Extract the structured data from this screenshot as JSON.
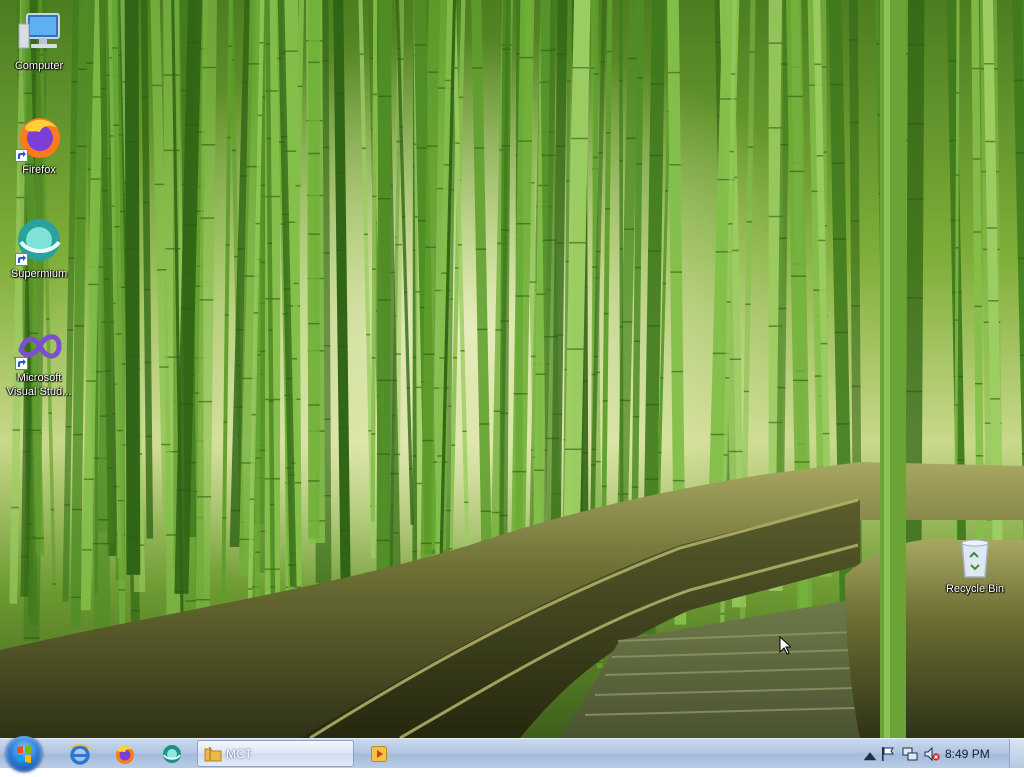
{
  "desktop": {
    "icons": [
      {
        "label": "Computer",
        "icon": "computer-icon"
      },
      {
        "label": "Firefox",
        "icon": "firefox-icon"
      },
      {
        "label": "Supermium",
        "icon": "supermium-icon"
      },
      {
        "label": "Microsoft Visual Stud...",
        "label_line1": "Microsoft",
        "label_line2": "Visual Stud...",
        "icon": "visual-studio-icon"
      },
      {
        "label": "Recycle Bin",
        "icon": "recycle-bin-icon"
      }
    ],
    "wallpaper": "bamboo-forest-path"
  },
  "taskbar": {
    "start_button": "start-orb-icon",
    "pinned": [
      "internet-explorer-icon",
      "firefox-icon",
      "supermium-icon"
    ],
    "windows": [
      {
        "label": "MCT",
        "icon": "folder-icon",
        "active": true
      },
      {
        "label": "",
        "icon": "media-player-icon",
        "active": false
      }
    ],
    "tray": {
      "icons": [
        "show-hidden-icons-arrow",
        "action-center-flag-icon",
        "network-icon",
        "volume-muted-icon"
      ],
      "clock": "8:49 PM"
    }
  },
  "colors": {
    "taskbar_top": "#c9d9ee",
    "taskbar_bottom": "#b9cce6",
    "bamboo_green": "#5f9e2c"
  }
}
